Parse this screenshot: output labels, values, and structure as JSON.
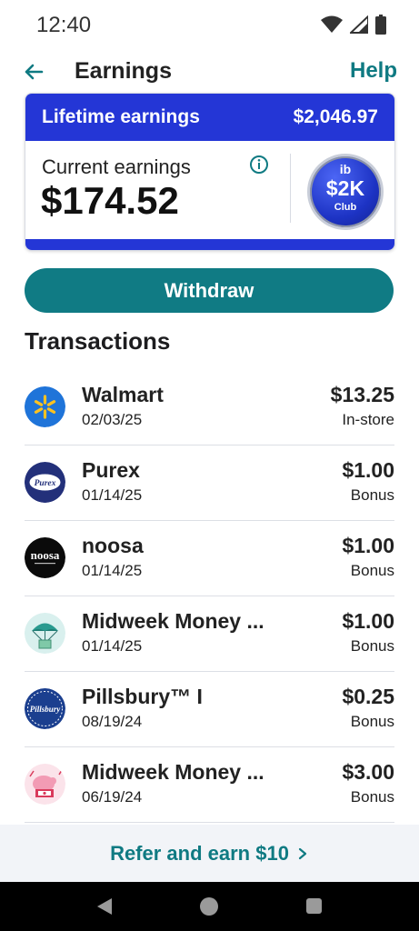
{
  "status": {
    "time": "12:40"
  },
  "header": {
    "title": "Earnings",
    "help": "Help"
  },
  "earnings": {
    "lifetime_label": "Lifetime earnings",
    "lifetime_value": "$2,046.97",
    "current_label": "Current earnings",
    "current_value": "$174.52",
    "badge": {
      "top": "ib",
      "middle": "$2K",
      "bottom": "Club"
    }
  },
  "withdraw_label": "Withdraw",
  "transactions_title": "Transactions",
  "transactions": [
    {
      "name": "Walmart",
      "date": "02/03/25",
      "amount": "$13.25",
      "type": "In-store",
      "logo": "walmart-logo"
    },
    {
      "name": "Purex",
      "date": "01/14/25",
      "amount": "$1.00",
      "type": "Bonus",
      "logo": "purex-logo",
      "logo_text": "Purex"
    },
    {
      "name": "noosa",
      "date": "01/14/25",
      "amount": "$1.00",
      "type": "Bonus",
      "logo": "noosa-logo",
      "logo_text": "noosa"
    },
    {
      "name": "Midweek Money ...",
      "date": "01/14/25",
      "amount": "$1.00",
      "type": "Bonus",
      "logo": "parachute-money-logo"
    },
    {
      "name": "Pillsbury™ I",
      "date": "08/19/24",
      "amount": "$0.25",
      "type": "Bonus",
      "logo": "pillsbury-logo",
      "logo_text": "Pillsbury"
    },
    {
      "name": "Midweek Money ...",
      "date": "06/19/24",
      "amount": "$3.00",
      "type": "Bonus",
      "logo": "piggy-bank-logo"
    }
  ],
  "refer": {
    "label": "Refer and earn $10"
  },
  "colors": {
    "brand_blue": "#2436d6",
    "teal": "#107b84"
  }
}
